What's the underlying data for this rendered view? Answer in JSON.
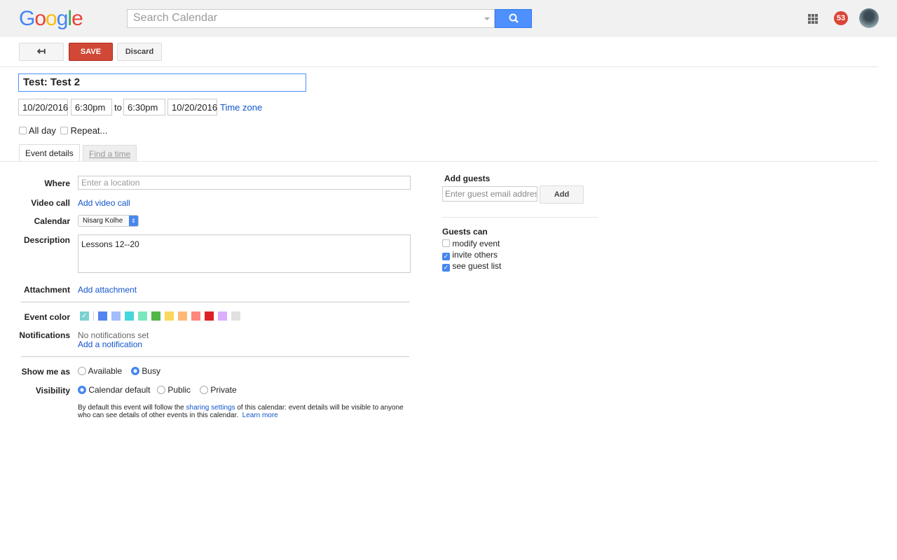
{
  "header": {
    "logo": "Google",
    "search_placeholder": "Search Calendar",
    "notifications_count": "53"
  },
  "toolbar": {
    "back_icon": "arrow-back-icon",
    "save_label": "SAVE",
    "discard_label": "Discard"
  },
  "event": {
    "title": "Test: Test 2",
    "start_date": "10/20/2016",
    "start_time": "6:30pm",
    "to_label": "to",
    "end_time": "6:30pm",
    "end_date": "10/20/2016",
    "time_zone_link": "Time zone",
    "all_day_label": "All day",
    "repeat_label": "Repeat..."
  },
  "tabs": [
    {
      "label": "Event details",
      "active": true
    },
    {
      "label": "Find a time",
      "active": false
    }
  ],
  "details": {
    "where_label": "Where",
    "where_placeholder": "Enter a location",
    "video_label": "Video call",
    "video_link": "Add video call",
    "calendar_label": "Calendar",
    "calendar_value": "Nisarg Kolhe",
    "description_label": "Description",
    "description_value": "Lessons 12--20",
    "attachment_label": "Attachment",
    "attachment_link": "Add attachment",
    "color_label": "Event color",
    "colors": [
      "#5484ed",
      "#a4bdfc",
      "#46d6db",
      "#7ae7bf",
      "#51b749",
      "#fbd75b",
      "#ffb878",
      "#ff887c",
      "#dc2127",
      "#dbadff",
      "#e1e1e1"
    ],
    "default_color": "#7bd1d1",
    "notifications_label": "Notifications",
    "notifications_value": "No notifications set",
    "add_notification_link": "Add a notification",
    "show_me_as_label": "Show me as",
    "show_options": [
      {
        "label": "Available",
        "selected": false
      },
      {
        "label": "Busy",
        "selected": true
      }
    ],
    "visibility_label": "Visibility",
    "visibility_options": [
      {
        "label": "Calendar default",
        "selected": true
      },
      {
        "label": "Public",
        "selected": false
      },
      {
        "label": "Private",
        "selected": false
      }
    ],
    "note_before": "By default this event will follow the ",
    "note_link": "sharing settings",
    "note_after": " of this calendar: event details will be visible to anyone",
    "note_line2": "who can see details of other events in this calendar.",
    "learn_more": "Learn more"
  },
  "guests": {
    "title": "Add guests",
    "placeholder": "Enter guest email addresses",
    "add_label": "Add",
    "can_title": "Guests can",
    "permissions": [
      {
        "label": "modify event",
        "checked": false
      },
      {
        "label": "invite others",
        "checked": true
      },
      {
        "label": "see guest list",
        "checked": true
      }
    ]
  }
}
